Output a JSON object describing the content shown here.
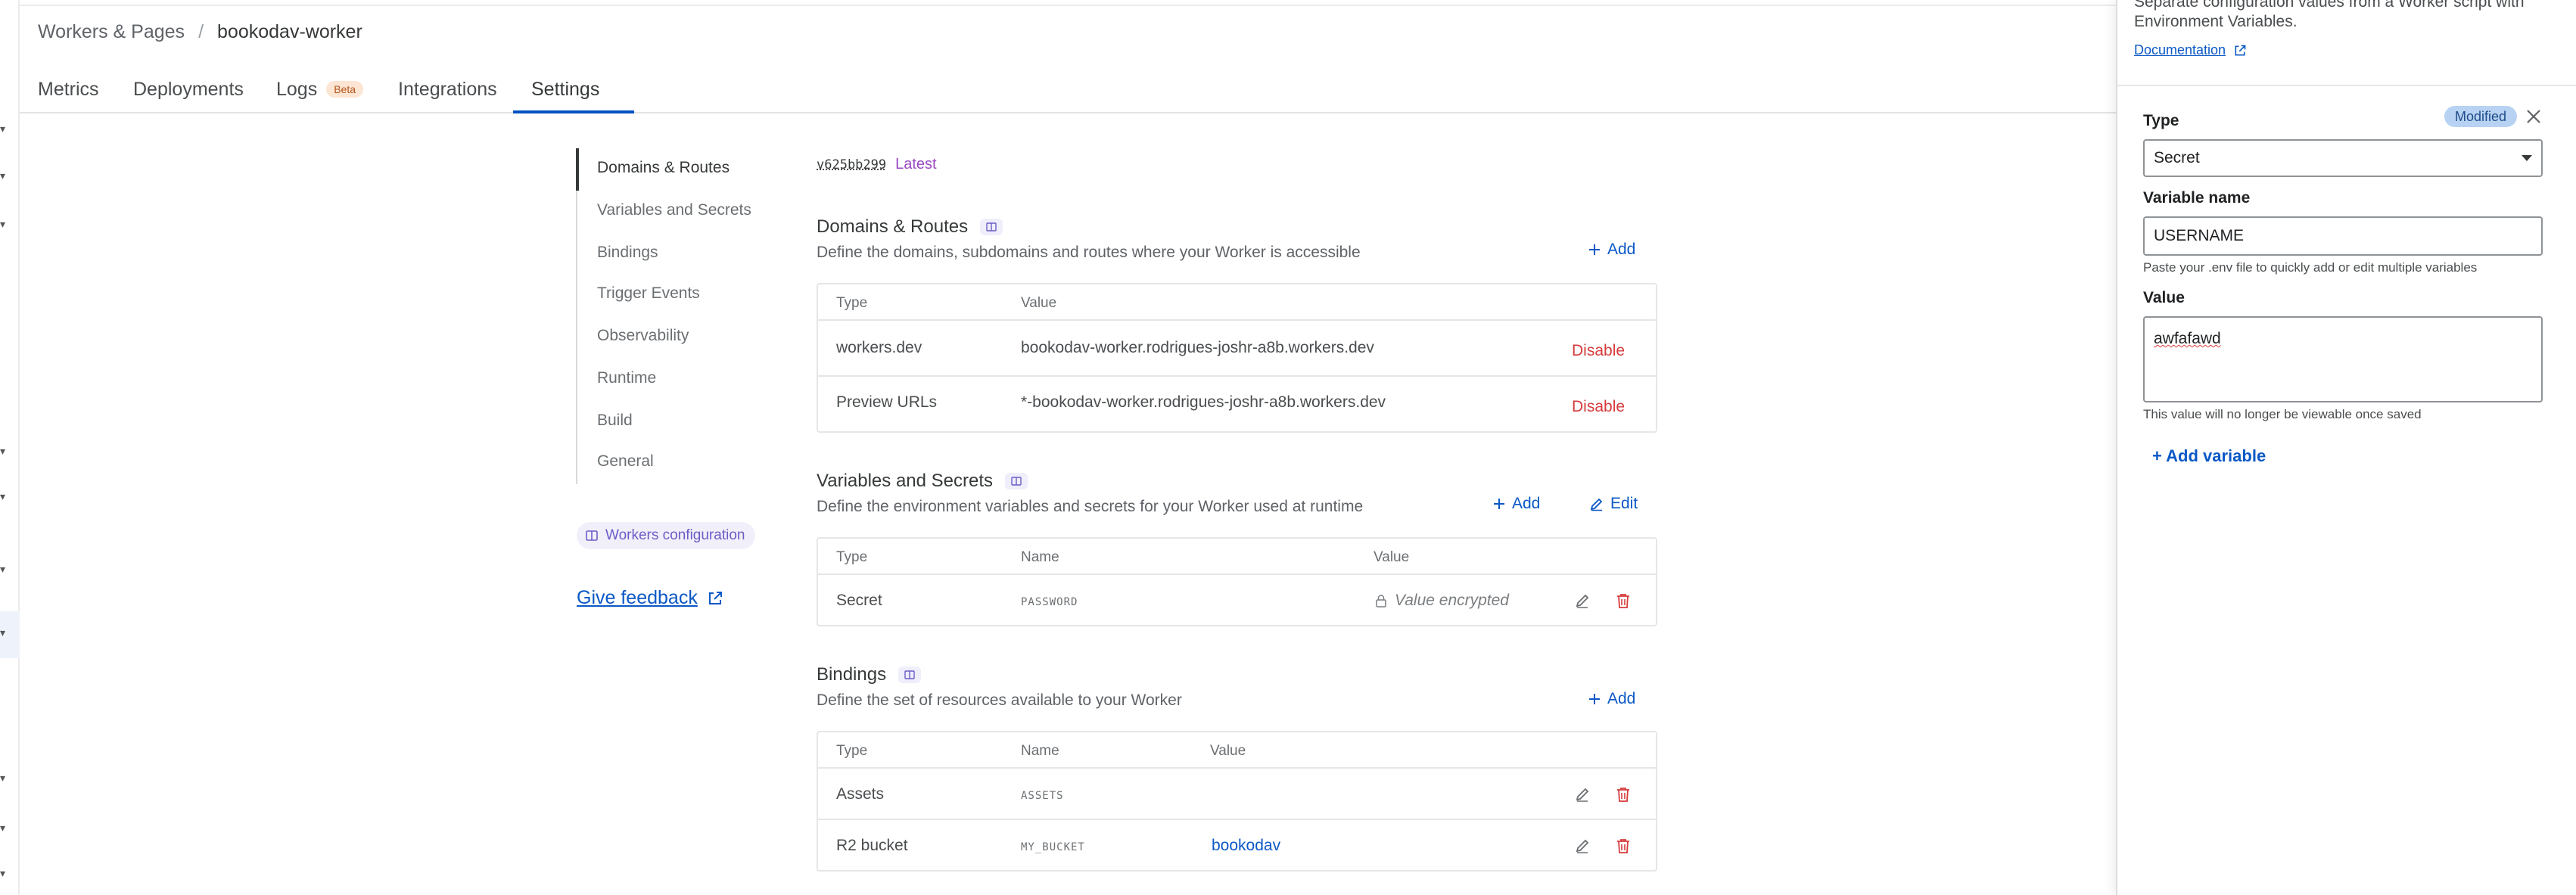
{
  "breadcrumb": {
    "parent": "Workers & Pages",
    "separator": "/",
    "current": "bookodav-worker"
  },
  "tabs": [
    {
      "label": "Metrics"
    },
    {
      "label": "Deployments"
    },
    {
      "label": "Logs",
      "badge": "Beta"
    },
    {
      "label": "Integrations"
    },
    {
      "label": "Settings",
      "active": true
    }
  ],
  "subnav": {
    "items": [
      "Domains & Routes",
      "Variables and Secrets",
      "Bindings",
      "Trigger Events",
      "Observability",
      "Runtime",
      "Build",
      "General"
    ],
    "active": "Domains & Routes",
    "workers_config": "Workers configuration",
    "give_feedback": "Give feedback"
  },
  "version": {
    "hash": "v625bb299",
    "tag": "Latest"
  },
  "domains": {
    "title": "Domains & Routes",
    "description": "Define the domains, subdomains and routes where your Worker is accessible",
    "add_label": "Add",
    "columns": [
      "Type",
      "Value"
    ],
    "rows": [
      {
        "type": "workers.dev",
        "value": "bookodav-worker.rodrigues-joshr-a8b.workers.dev",
        "action": "Disable"
      },
      {
        "type": "Preview URLs",
        "value": "*-bookodav-worker.rodrigues-joshr-a8b.workers.dev",
        "action": "Disable"
      }
    ]
  },
  "variables": {
    "title": "Variables and Secrets",
    "description": "Define the environment variables and secrets for your Worker used at runtime",
    "add_label": "Add",
    "edit_label": "Edit",
    "columns": [
      "Type",
      "Name",
      "Value"
    ],
    "rows": [
      {
        "type": "Secret",
        "name": "PASSWORD",
        "value": "Value encrypted"
      }
    ]
  },
  "bindings": {
    "title": "Bindings",
    "description": "Define the set of resources available to your Worker",
    "add_label": "Add",
    "columns": [
      "Type",
      "Name",
      "Value"
    ],
    "rows": [
      {
        "type": "Assets",
        "name": "ASSETS",
        "value": ""
      },
      {
        "type": "R2 bucket",
        "name": "MY_BUCKET",
        "value": "bookodav"
      }
    ]
  },
  "panel": {
    "intro": "Separate configuration values from a Worker script with Environment Variables.",
    "documentation": "Documentation",
    "type_label": "Type",
    "modified_badge": "Modified",
    "type_value": "Secret",
    "name_label": "Variable name",
    "name_value": "USERNAME",
    "name_hint": "Paste your .env file to quickly add or edit multiple variables",
    "value_label": "Value",
    "value_value": "awfafawd",
    "value_hint": "This value will no longer be viewable once saved",
    "add_variable": "+ Add variable"
  },
  "colors": {
    "accent": "#0b58c6",
    "danger": "#d63b3b",
    "latest": "#9a48c2",
    "modified_bg": "#b7d2f2"
  },
  "icons": [
    "external-link-icon",
    "book-icon",
    "plus-icon",
    "pencil-icon",
    "trash-icon",
    "lock-icon",
    "close-icon",
    "chevron-down-icon"
  ]
}
